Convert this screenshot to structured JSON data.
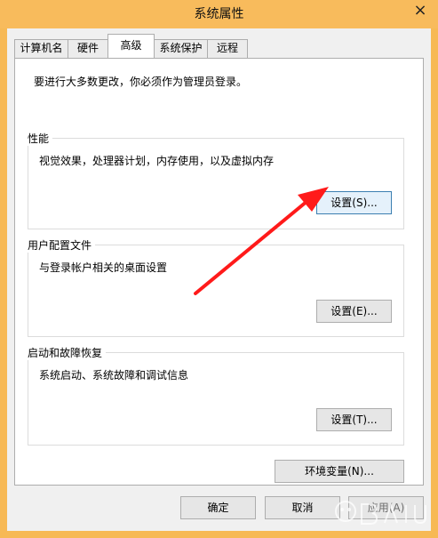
{
  "window": {
    "title": "系统属性",
    "close_glyph": "×"
  },
  "tabs": [
    {
      "label": "计算机名"
    },
    {
      "label": "硬件"
    },
    {
      "label": "高级",
      "active": true
    },
    {
      "label": "系统保护"
    },
    {
      "label": "远程"
    }
  ],
  "panel": {
    "admin_note": "要进行大多数更改，你必须作为管理员登录。",
    "performance": {
      "title": "性能",
      "description": "视觉效果，处理器计划，内存使用，以及虚拟内存",
      "button_label": "设置(S)..."
    },
    "user_profiles": {
      "title": "用户配置文件",
      "description": "与登录帐户相关的桌面设置",
      "button_label": "设置(E)..."
    },
    "startup_recovery": {
      "title": "启动和故障恢复",
      "description": "系统启动、系统故障和调试信息",
      "button_label": "设置(T)..."
    },
    "env_button_label": "环境变量(N)..."
  },
  "footer": {
    "ok_label": "确定",
    "cancel_label": "取消",
    "apply_label": "应用(A)"
  },
  "colors": {
    "title_bar": "#f8bb5c",
    "annotation_arrow": "#ff1a1a"
  },
  "icons": {
    "close": "close-icon",
    "arrow": "annotation-arrow"
  }
}
